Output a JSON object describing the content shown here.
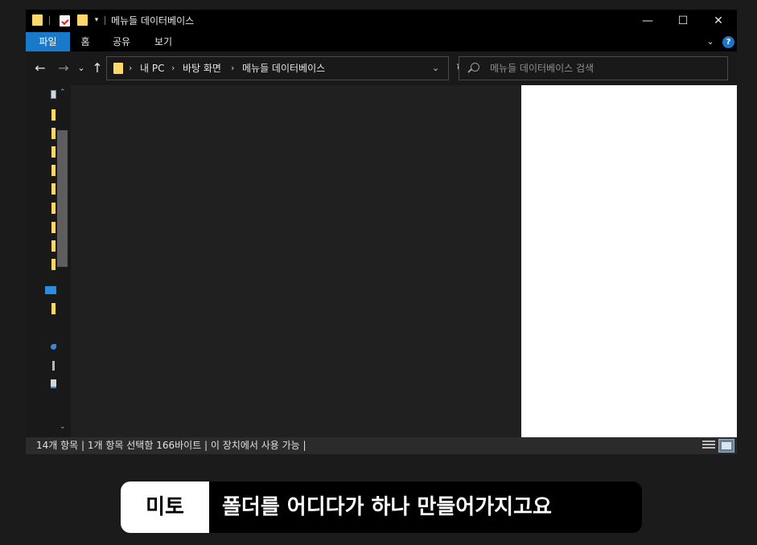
{
  "titlebar": {
    "title": "메뉴들 데이터베이스",
    "qa_dropdown": "▾",
    "minimize": "—",
    "maximize": "☐",
    "close": "✕"
  },
  "ribbon": {
    "tabs": [
      {
        "label": "파일",
        "active": true
      },
      {
        "label": "홈"
      },
      {
        "label": "공유"
      },
      {
        "label": "보기"
      }
    ],
    "expand_chevron": "⌄",
    "help": "?"
  },
  "nav": {
    "back": "←",
    "forward": "→",
    "recent": "⌄",
    "up": "↑",
    "breadcrumbs": [
      "내 PC",
      "바탕 화면",
      "메뉴들 데이터베이스"
    ],
    "crumb_separator": "›",
    "address_dropdown": "⌄",
    "refresh": "↻"
  },
  "search": {
    "placeholder": "메뉴들 데이터베이스 검색"
  },
  "navpane": {
    "scroll_up": "⌃",
    "scroll_down": "⌄",
    "icons": [
      "pc-icon",
      "folder-icon",
      "folder-icon",
      "folder-icon",
      "folder-icon",
      "folder-icon",
      "folder-icon",
      "folder-icon",
      "folder-icon",
      "folder-icon",
      "desktop-icon",
      "folder-icon",
      "drive-icon",
      "usb-icon",
      "network-icon"
    ]
  },
  "statusbar": {
    "text": "14개 항목  |  1개 항목 선택함 166바이트  |  이 장치에서 사용 가능  |"
  },
  "caption": {
    "speaker": "미토",
    "text": "폴더를 어디다가 하나 만들어가지고요"
  },
  "colors": {
    "accent": "#1979ca",
    "folder": "#ffd86b",
    "window_bg": "#191919",
    "content_bg": "#202020",
    "preview_bg": "#ffffff"
  }
}
